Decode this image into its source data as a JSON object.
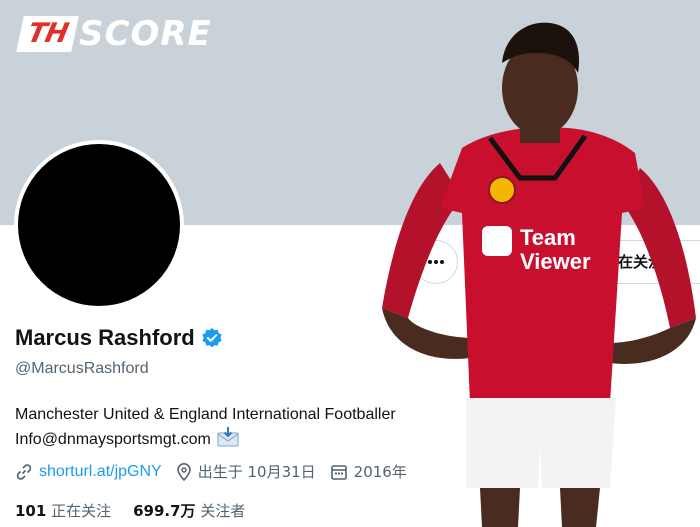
{
  "banner": {
    "logo_prefix": "TH",
    "logo_suffix": "SCORE"
  },
  "profile": {
    "display_name": "Marcus Rashford",
    "handle": "@MarcusRashford",
    "bio_line1": "Manchester United & England International Footballer",
    "bio_line2": "Info@dnmaysportsmgt.com",
    "link": "shorturl.at/jpGNY",
    "birthday": "出生于 10月31日",
    "joined": "2016年",
    "following_count": "101",
    "following_label": "正在关注",
    "followers_count": "699.7万",
    "followers_label": "关注者"
  },
  "actions": {
    "follow_label": "正在关注",
    "more_icon": "more-icon"
  },
  "player": {
    "sponsor_line1": "Team",
    "sponsor_line2": "Viewer"
  },
  "colors": {
    "accent": "#1d9bf0",
    "banner": "#c9d2d8",
    "kit": "#c8102e"
  }
}
